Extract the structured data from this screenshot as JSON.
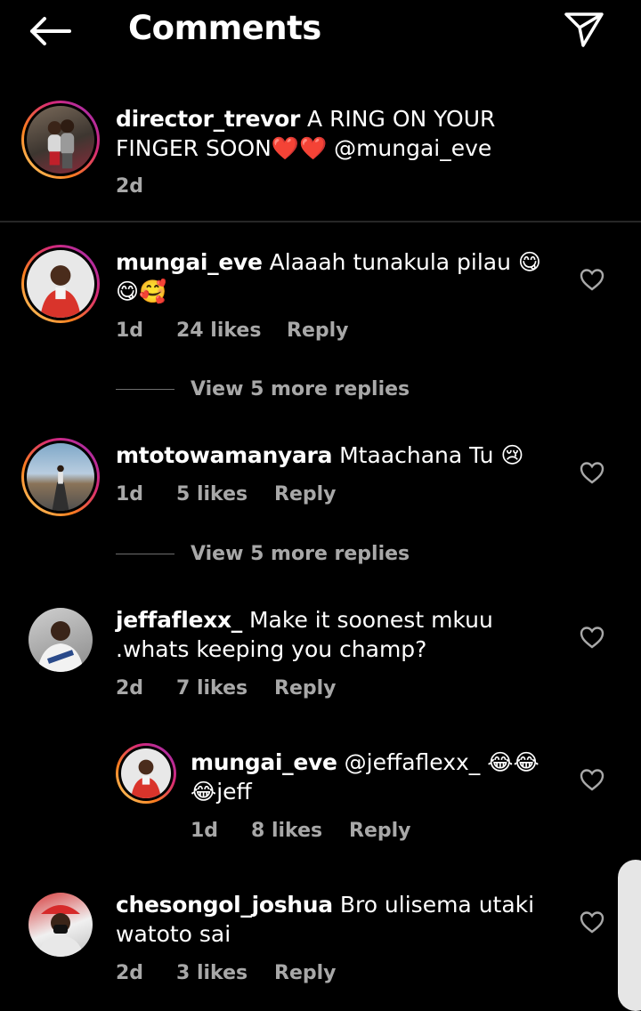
{
  "header": {
    "title": "Comments"
  },
  "caption": {
    "username": "director_trevor",
    "text": "A RING ON YOUR FINGER SOON❤️❤️ @mungai_eve",
    "time": "2d"
  },
  "comments": [
    {
      "username": "mungai_eve",
      "text": "Alaaah tunakula pilau 😋😋🥰",
      "time": "1d",
      "likes": "24 likes",
      "reply": "Reply",
      "view_replies": "View 5 more replies"
    },
    {
      "username": "mtotowamanyara",
      "text": "Mtaachana Tu 😢",
      "time": "1d",
      "likes": "5 likes",
      "reply": "Reply",
      "view_replies": "View 5 more replies"
    },
    {
      "username": "jeffaflexx_",
      "text": "Make it soonest mkuu .whats keeping you champ?",
      "time": "2d",
      "likes": "7 likes",
      "reply": "Reply"
    },
    {
      "username": "mungai_eve",
      "text": "@jeffaflexx_ 😂😂😂jeff",
      "time": "1d",
      "likes": "8 likes",
      "reply": "Reply"
    },
    {
      "username": "chesongol_joshua",
      "text": "Bro ulisema utaki watoto sai",
      "time": "2d",
      "likes": "3 likes",
      "reply": "Reply"
    }
  ],
  "icons": {
    "back": "arrow-left-icon",
    "share": "paper-plane-icon",
    "like": "heart-outline-icon"
  },
  "colors": {
    "background": "#000000",
    "secondary_text": "#a8a8a8",
    "story_ring": "#d62976"
  }
}
